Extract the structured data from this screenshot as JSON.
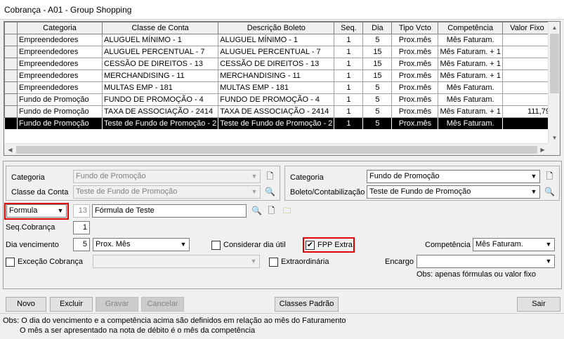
{
  "window": {
    "title": "Cobrança - A01 - Group Shopping"
  },
  "grid": {
    "columns": [
      "Categoria",
      "Classe de Conta",
      "Descrição Boleto",
      "Seq.",
      "Dia",
      "Tipo Vcto",
      "Competência",
      "Valor Fixo"
    ],
    "rows": [
      [
        "Empreendedores",
        "ALUGUEL MÍNIMO - 1",
        "ALUGUEL MÍNIMO - 1",
        "1",
        "5",
        "Prox.mês",
        "Mês Faturam.",
        ""
      ],
      [
        "Empreendedores",
        "ALUGUEL PERCENTUAL - 7",
        "ALUGUEL PERCENTUAL - 7",
        "1",
        "15",
        "Prox.mês",
        "Mês Faturam. + 1",
        ""
      ],
      [
        "Empreendedores",
        "CESSÃO DE DIREITOS - 13",
        "CESSÃO DE DIREITOS - 13",
        "1",
        "15",
        "Prox.mês",
        "Mês Faturam. + 1",
        ""
      ],
      [
        "Empreendedores",
        "MERCHANDISING - 11",
        "MERCHANDISING - 11",
        "1",
        "15",
        "Prox.mês",
        "Mês Faturam. + 1",
        ""
      ],
      [
        "Empreendedores",
        "MULTAS EMP - 181",
        "MULTAS EMP - 181",
        "1",
        "5",
        "Prox.mês",
        "Mês Faturam.",
        ""
      ],
      [
        "Fundo de Promoção",
        "FUNDO DE PROMOÇÃO - 4",
        "FUNDO DE PROMOÇÃO - 4",
        "1",
        "5",
        "Prox.mês",
        "Mês Faturam.",
        ""
      ],
      [
        "Fundo de Promoção",
        "TAXA DE ASSOCIAÇÃO - 2414",
        "TAXA DE ASSOCIAÇÃO - 2414",
        "1",
        "5",
        "Prox.mês",
        "Mês Faturam. + 1",
        "111,79"
      ],
      [
        "Fundo de Promoção",
        "Teste de Fundo de Promoção - 2",
        "Teste de Fundo de Promoção - 2",
        "1",
        "5",
        "Prox.mês",
        "Mês Faturam.",
        ""
      ]
    ],
    "selected_row": 7
  },
  "form": {
    "left": {
      "categoria_label": "Categoria",
      "categoria_value": "Fundo de Promoção",
      "classe_label": "Classe da Conta",
      "classe_value": "Teste de Fundo de Promoção"
    },
    "right": {
      "categoria_label": "Categoria",
      "categoria_value": "Fundo de Promoção",
      "boleto_label": "Boleto/Contabilização",
      "boleto_value": "Teste de Fundo de Promoção"
    },
    "formula_type": "Formula",
    "formula_code": "13",
    "formula_name": "Fórmula de Teste",
    "seq_label": "Seq.Cobrança",
    "seq_value": "1",
    "dia_label": "Dia vencimento",
    "dia_value": "5",
    "dia_tipo": "Prox. Mês",
    "considerar_label": "Considerar dia útil",
    "considerar_checked": false,
    "fpp_label": "FPP Extra",
    "fpp_checked": true,
    "competencia_label": "Competência",
    "competencia_value": "Mês Faturam.",
    "excecao_label": "Exceção Cobrança",
    "excecao_value": "",
    "extraordinaria_label": "Extraordinária",
    "encargo_label": "Encargo",
    "encargo_value": "",
    "obs_encargo": "Obs: apenas fórmulas ou valor fixo"
  },
  "buttons": {
    "novo": "Novo",
    "excluir": "Excluir",
    "gravar": "Gravar",
    "cancelar": "Cancelar",
    "classes_padrao": "Classes Padrão",
    "sair": "Sair"
  },
  "footer": {
    "line1": "Obs: O dia do vencimento e a competência acima são definidos em relação ao mês do Faturamento",
    "line2": "O mês a ser apresentado na nota de débito é o mês da competência"
  },
  "colors": {
    "highlight": "#e00000",
    "selected_row": "#000000"
  },
  "icons": [
    "binoculars-icon",
    "new-document-icon",
    "folder-icon",
    "dropdown-arrow-icon",
    "checkmark-icon"
  ]
}
